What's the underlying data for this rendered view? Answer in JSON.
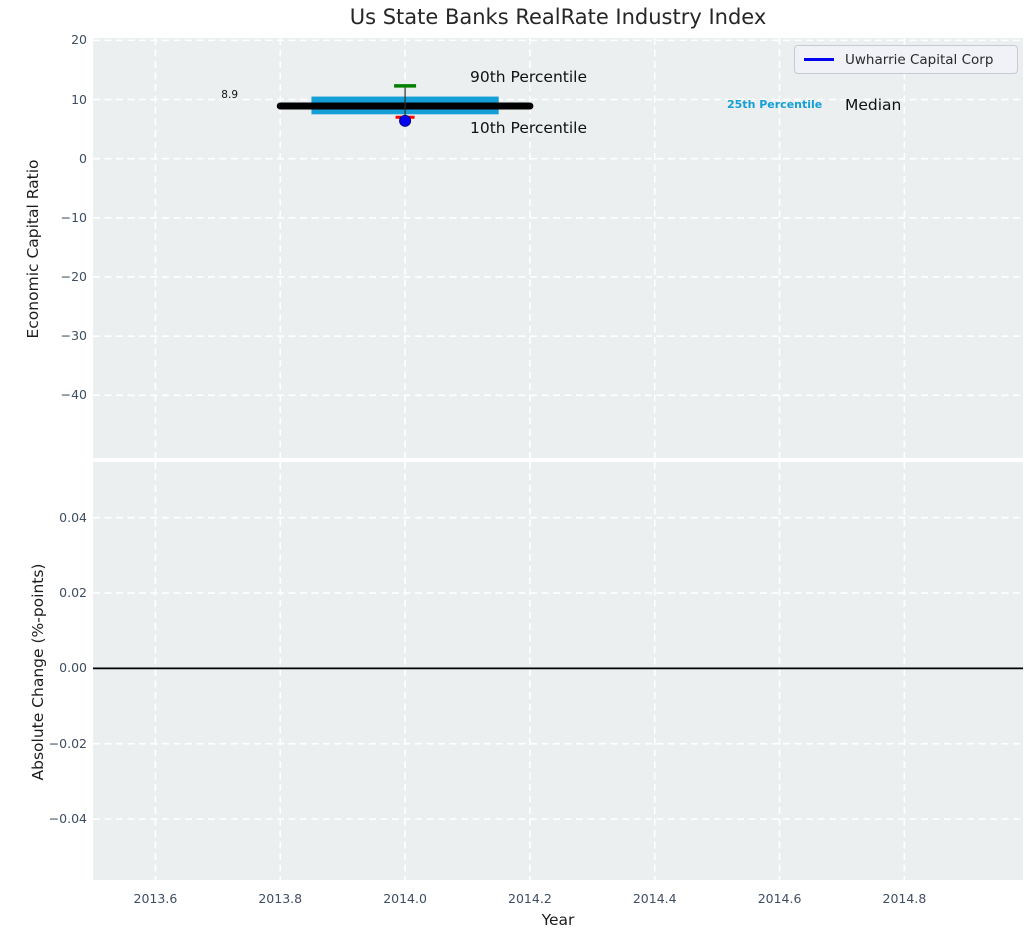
{
  "figure": {
    "title": "Us State Banks RealRate Industry Index",
    "colors": {
      "figure_bg": "#ffffff",
      "plot_bg": "#ebeff0",
      "grid": "#ffffff",
      "tick_label": "#3e4e63",
      "text": "#1c1c1c",
      "median_line": "#000000",
      "iqr_band": "#149fd6",
      "p90_marker": "#008000",
      "p10_marker": "#ff0000",
      "company_line": "#0202f0",
      "company_marker_edge": "#000080"
    }
  },
  "legend": {
    "label": "Uwharrie Capital Corp",
    "line_color": "#0202f0",
    "position": "upper right"
  },
  "annotations": {
    "p90_label": "90th Percentile",
    "p10_label": "10th Percentile",
    "p25_label": "25th Percentile",
    "median_label": "Median",
    "median_value_label": "8.9"
  },
  "chart_data": [
    {
      "type": "line",
      "title": "Us State Banks RealRate Industry Index",
      "xlabel": "Year",
      "ylabel": "Economic Capital Ratio",
      "xlim": [
        2013.5,
        2014.99
      ],
      "ylim": [
        -50.6,
        20.4
      ],
      "xticks": [
        2013.6,
        2013.8,
        2014.0,
        2014.2,
        2014.4,
        2014.6,
        2014.8
      ],
      "xtick_labels": [
        "2013.6",
        "2013.8",
        "2014.0",
        "2014.2",
        "2014.4",
        "2014.6",
        "2014.8"
      ],
      "show_xtick_labels": false,
      "yticks": [
        20,
        10,
        0,
        -10,
        -20,
        -30,
        -40
      ],
      "ytick_labels": [
        "20",
        "10",
        "0",
        "−10",
        "−20",
        "−30",
        "−40"
      ],
      "grid": "dashed-white",
      "legend_position": "upper right",
      "industry_summary": {
        "median": {
          "value": 8.9,
          "x_start": 2013.8,
          "x_end": 2014.2,
          "color": "#000000"
        },
        "iqr_band": {
          "p25": 7.5,
          "p75": 10.5,
          "x_start": 2013.85,
          "x_end": 2014.15,
          "color": "#149fd6"
        },
        "p90": {
          "value": 12.3,
          "x": 2014.0,
          "color": "#008000"
        },
        "p10": {
          "value": 7.0,
          "x": 2014.0,
          "color": "#ff0000"
        }
      },
      "series": [
        {
          "name": "Uwharrie Capital Corp",
          "x": [
            2014.0
          ],
          "y": [
            6.4
          ],
          "color": "#0202f0",
          "marker": "circle"
        }
      ]
    },
    {
      "type": "line",
      "title": "",
      "xlabel": "Year",
      "ylabel": "Absolute Change (%-points)",
      "xlim": [
        2013.5,
        2014.99
      ],
      "ylim": [
        -0.0562,
        0.0548
      ],
      "xticks": [
        2013.6,
        2013.8,
        2014.0,
        2014.2,
        2014.4,
        2014.6,
        2014.8
      ],
      "xtick_labels": [
        "2013.6",
        "2013.8",
        "2014.0",
        "2014.2",
        "2014.4",
        "2014.6",
        "2014.8"
      ],
      "show_xtick_labels": true,
      "yticks": [
        0.04,
        0.02,
        0.0,
        -0.02,
        -0.04
      ],
      "ytick_labels": [
        "0.04",
        "0.02",
        "0.00",
        "−0.02",
        "−0.04"
      ],
      "grid": "dashed-white",
      "zero_line": {
        "value": 0.0,
        "color": "#000000"
      },
      "series": []
    }
  ]
}
